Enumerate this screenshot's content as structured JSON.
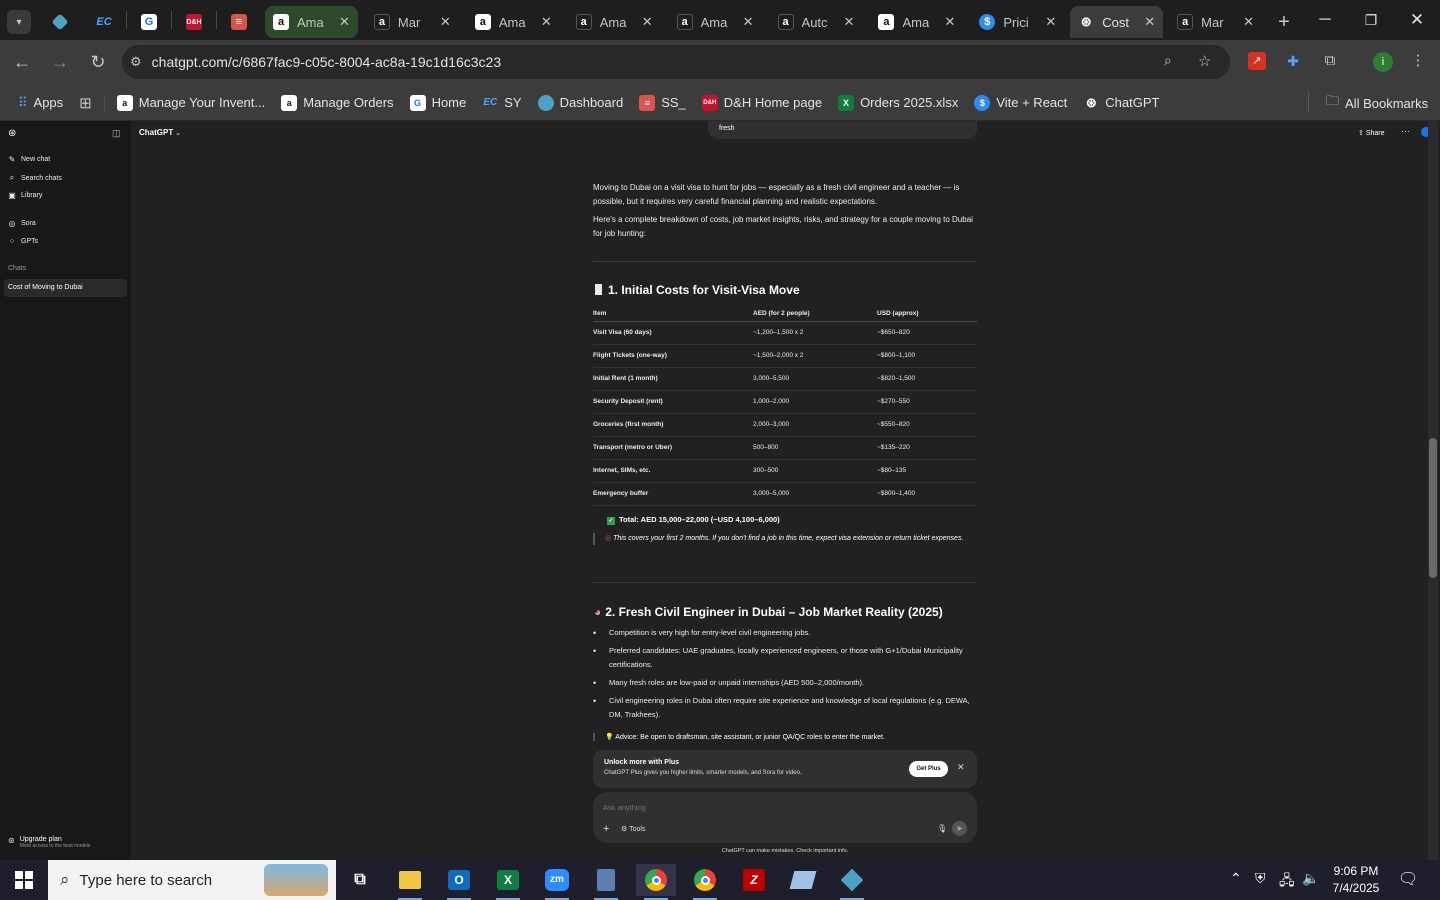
{
  "browser": {
    "tabs": [
      {
        "title": "",
        "icon": "tab-menu-icon"
      },
      {
        "title": "",
        "icon": "app-diamond-icon"
      },
      {
        "title": "",
        "icon": "ec-icon"
      },
      {
        "title": "",
        "icon": "g-doc-icon"
      },
      {
        "title": "",
        "icon": "dh-icon"
      },
      {
        "title": "",
        "icon": "stack-icon"
      },
      {
        "title": "Ama",
        "icon": "amazon-icon"
      },
      {
        "title": "Mar",
        "icon": "amazon-icon"
      },
      {
        "title": "Ama",
        "icon": "amazon-icon"
      },
      {
        "title": "Ama",
        "icon": "amazon-icon"
      },
      {
        "title": "Ama",
        "icon": "amazon-icon"
      },
      {
        "title": "Autc",
        "icon": "amazon-icon"
      },
      {
        "title": "Ama",
        "icon": "amazon-icon"
      },
      {
        "title": "Prici",
        "icon": "pricing-icon"
      },
      {
        "title": "Cost",
        "icon": "chatgpt-icon"
      },
      {
        "title": "Mar",
        "icon": "amazon-icon"
      }
    ],
    "url": "chatgpt.com/c/6867fac9-c05c-8004-ac8a-19c1d16c3c23",
    "bookmarks": [
      {
        "label": "Apps"
      },
      {
        "label": ""
      },
      {
        "label": "Manage Your Invent..."
      },
      {
        "label": "Manage Orders"
      },
      {
        "label": "Home"
      },
      {
        "label": "SY"
      },
      {
        "label": "Dashboard"
      },
      {
        "label": "SS_"
      },
      {
        "label": "D&H Home page"
      },
      {
        "label": "Orders 2025.xlsx"
      },
      {
        "label": "Vite + React"
      },
      {
        "label": "ChatGPT"
      }
    ],
    "all_bookmarks": "All Bookmarks",
    "profile_letter": "i"
  },
  "sidebar": {
    "items": [
      "New chat",
      "Search chats",
      "Library",
      "Sora",
      "GPTs"
    ],
    "section_label": "Chats",
    "chats": [
      "Cost of Moving to Dubai"
    ],
    "upgrade": "Upgrade plan",
    "upgrade_sub": "More access to the best models"
  },
  "header": {
    "model": "ChatGPT",
    "share": "Share"
  },
  "chat": {
    "prev_bubble": "fresh",
    "intro1": "Moving to Dubai on a visit visa to hunt for jobs — especially as a fresh civil engineer and a teacher — is possible, but it requires very careful financial planning and realistic expectations.",
    "intro2": "Here's a complete breakdown of costs, job market insights, risks, and strategy for a couple moving to Dubai for job hunting:",
    "section1": "1. Initial Costs for Visit-Visa Move",
    "table_headers": [
      "Item",
      "AED (for 2 people)",
      "USD (approx)"
    ],
    "table_rows": [
      [
        "Visit Visa (60 days)",
        "~1,200–1,500 x 2",
        "~$650–820"
      ],
      [
        "Flight Tickets (one-way)",
        "~1,500–2,000 x 2",
        "~$800–1,100"
      ],
      [
        "Initial Rent (1 month)",
        "3,000–5,500",
        "~$820–1,500"
      ],
      [
        "Security Deposit (rent)",
        "1,000–2,000",
        "~$270–550"
      ],
      [
        "Groceries (first month)",
        "2,000–3,000",
        "~$550–820"
      ],
      [
        "Transport (metro or Uber)",
        "500–800",
        "~$135–220"
      ],
      [
        "Internet, SIMs, etc.",
        "300–500",
        "~$80–135"
      ],
      [
        "Emergency buffer",
        "3,000–5,000",
        "~$800–1,400"
      ]
    ],
    "total": "Total: AED 15,000–22,000 (~USD 4,100–6,000)",
    "note": "This covers your first 2 months. If you don't find a job in this time, expect visa extension or return ticket expenses.",
    "section2": "2. Fresh Civil Engineer in Dubai – Job Market Reality (2025)",
    "bullets": [
      "Competition is very high for entry-level civil engineering jobs.",
      "Preferred candidates: UAE graduates, locally experienced engineers, or those with G+1/Dubai Municipality certifications.",
      "Many fresh roles are low-paid or unpaid internships (AED 500–2,000/month).",
      "Civil engineering roles in Dubai often require site experience and knowledge of local regulations (e.g. DEWA, DM, Trakhees)."
    ],
    "advice": "Advice: Be open to draftsman, site assistant, or junior QA/QC roles to enter the market."
  },
  "plus_banner": {
    "title": "Unlock more with Plus",
    "subtitle": "ChatGPT Plus gives you higher limits, smarter models, and Sora for video.",
    "button": "Get Plus"
  },
  "composer": {
    "placeholder": "Ask anything",
    "tools": "Tools",
    "disclaimer": "ChatGPT can make mistakes. Check important info."
  },
  "taskbar": {
    "search_placeholder": "Type here to search",
    "time": "9:06 PM",
    "date": "7/4/2025",
    "apps": [
      "task-view-icon",
      "file-explorer-icon",
      "outlook-icon",
      "excel-icon",
      "zoom-icon",
      "calculator-icon",
      "chrome-icon",
      "chrome-icon",
      "filezilla-icon",
      "notepad-icon",
      "app-diamond-icon"
    ]
  },
  "colors": {
    "accent_blue": "#1a73e8",
    "tab_active": "#3c3c3c",
    "bg_dark": "#212121"
  }
}
